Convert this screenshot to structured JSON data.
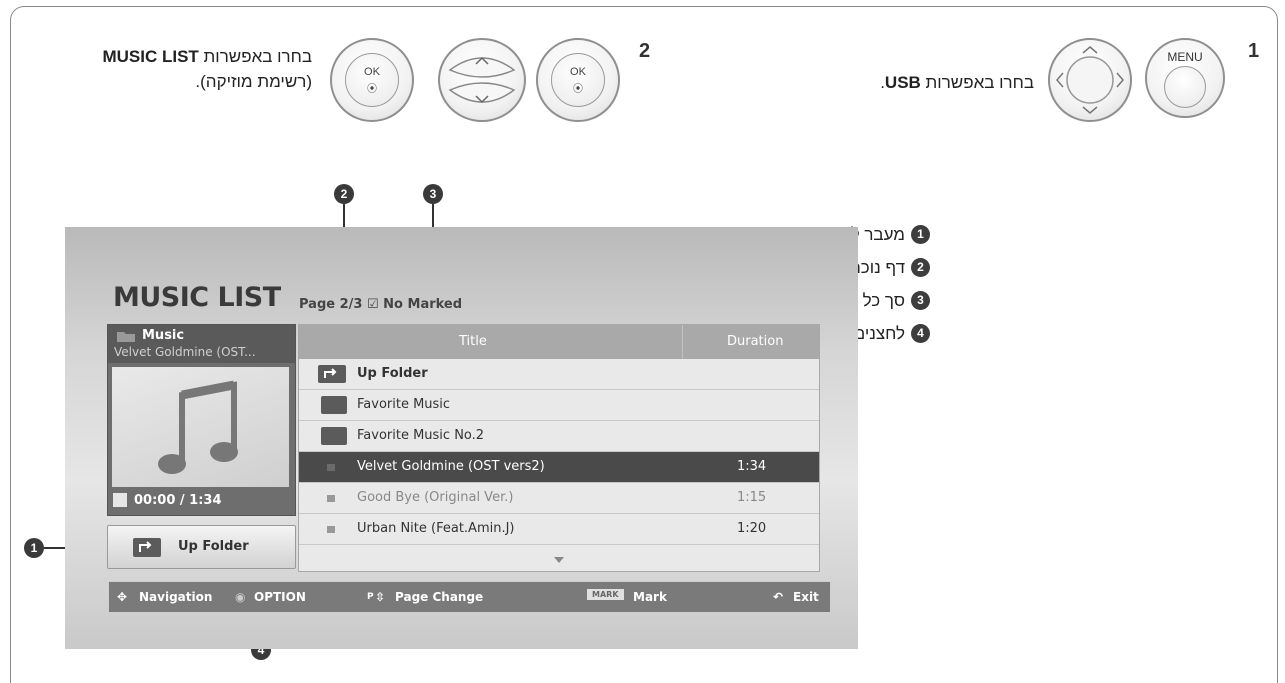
{
  "steps": [
    {
      "number": "1",
      "instruction_prefix": "בחרו באפשרות ",
      "instruction_bold": "USB",
      "instruction_suffix": ".",
      "menu_button_label": "MENU"
    },
    {
      "number": "2",
      "instruction_line1_prefix": "בחרו באפשרות ",
      "instruction_line1_bold": "MUSIC LIST",
      "instruction_line2": "(רשימת מוזיקה).",
      "ok_label": "OK"
    }
  ],
  "legend": [
    {
      "num": "1",
      "text": "מעבר לתיקייה ברמה גבוהה יותר"
    },
    {
      "num": "2",
      "text": "דף נוכחי/סך הדפים"
    },
    {
      "num": "3",
      "text": "סך כל קובצי המוזיקה המסומנים"
    },
    {
      "num": "4",
      "text": "לחצנים מתאימים בשלט הרחוק"
    }
  ],
  "screen": {
    "title": "MUSIC LIST",
    "page_info": "Page 2/3",
    "marked_info": "No Marked",
    "preview": {
      "label": "Music",
      "subtitle": "Velvet Goldmine (OST...",
      "time": "00:00 / 1:34"
    },
    "up_button": "Up Folder",
    "columns": {
      "title": "Title",
      "duration": "Duration"
    },
    "rows": [
      {
        "type": "up",
        "title": "Up Folder",
        "duration": ""
      },
      {
        "type": "folder",
        "title": "Favorite Music",
        "duration": ""
      },
      {
        "type": "folder",
        "title": "Favorite Music No.2",
        "duration": ""
      },
      {
        "type": "song",
        "title": "Velvet Goldmine (OST vers2)",
        "duration": "1:34",
        "selected": true
      },
      {
        "type": "song",
        "title": "Good Bye (Original Ver.)",
        "duration": "1:15",
        "dim": true
      },
      {
        "type": "song",
        "title": "Urban Nite (Feat.Amin.J)",
        "duration": "1:20"
      }
    ],
    "statusbar": {
      "navigation": "Navigation",
      "option": "OPTION",
      "page_change": "Page Change",
      "page_key": "P",
      "mark_key": "MARK",
      "mark": "Mark",
      "exit": "Exit"
    }
  },
  "callouts": [
    "1",
    "2",
    "3",
    "4"
  ]
}
